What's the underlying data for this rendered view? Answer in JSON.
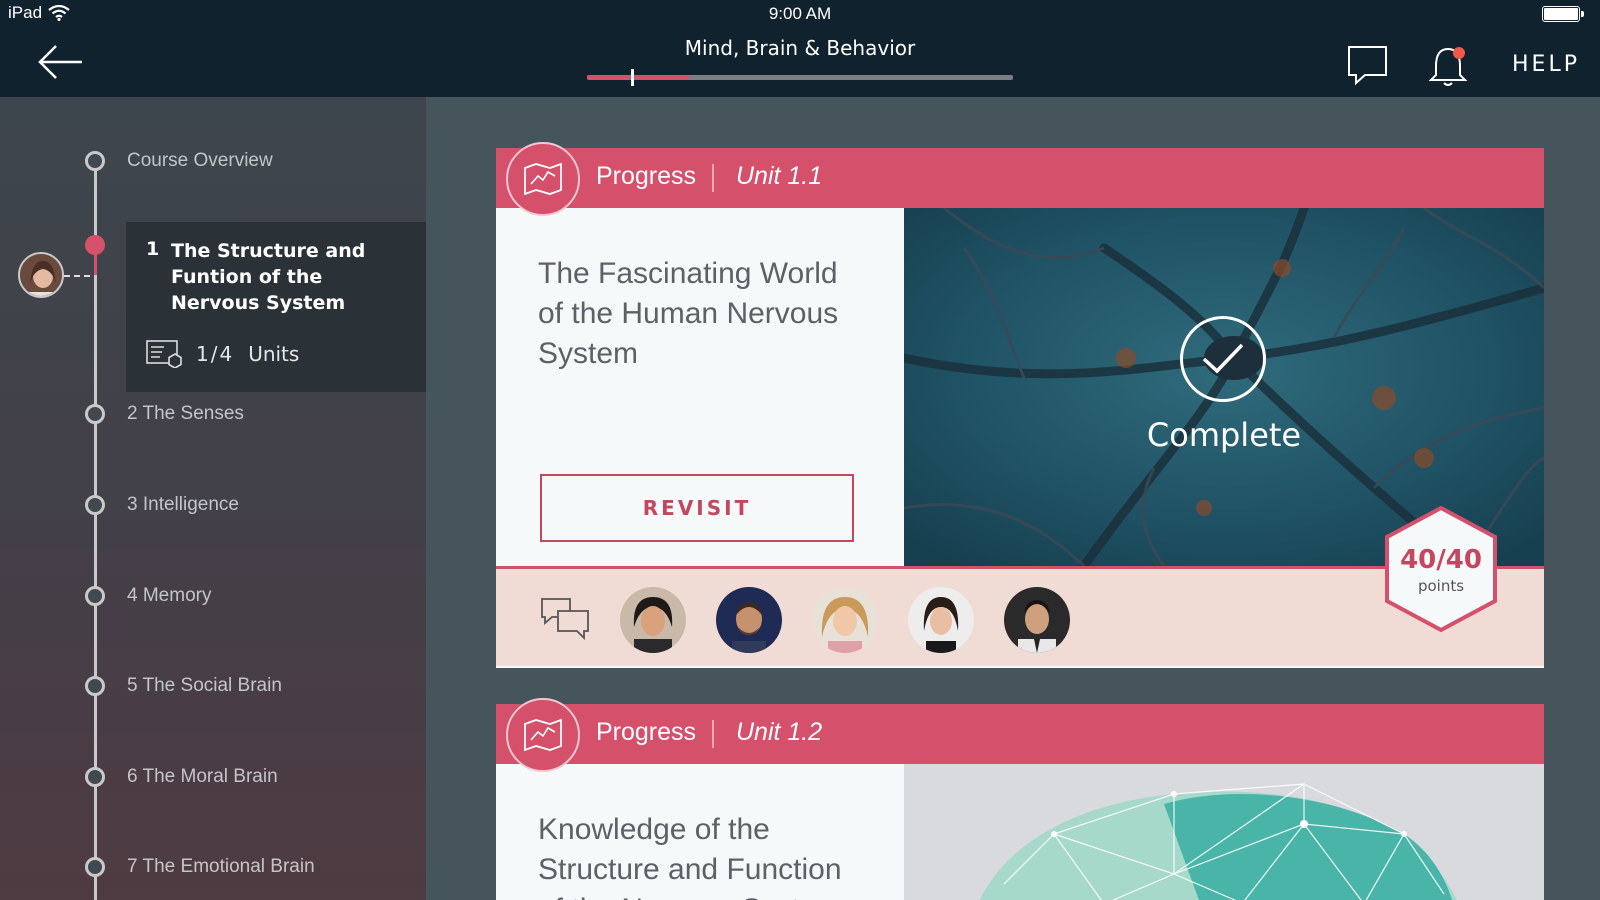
{
  "status_bar": {
    "device": "iPad",
    "time": "9:00 AM"
  },
  "header": {
    "course_title": "Mind, Brain & Behavior",
    "course_progress_fraction": 0.24,
    "help_label": "HELP"
  },
  "sidebar": {
    "items": [
      {
        "label": "Course Overview"
      },
      {
        "label": "2 The Senses"
      },
      {
        "label": "3 Intelligence"
      },
      {
        "label": "4 Memory"
      },
      {
        "label": "5 The Social Brain"
      },
      {
        "label": "6 The Moral Brain"
      },
      {
        "label": "7 The Emotional Brain"
      }
    ],
    "active": {
      "number": "1",
      "title": "The Structure and Funtion of the Nervous System",
      "units_count": "1/4",
      "units_label": "Units"
    }
  },
  "cards": [
    {
      "progress_label": "Progress",
      "unit": "Unit 1.1",
      "title": "The Fascinating World of the Human Nervous System",
      "action_label": "REVISIT",
      "status_label": "Complete",
      "points": "40/40",
      "points_label": "points"
    },
    {
      "progress_label": "Progress",
      "unit": "Unit 1.2",
      "title": "Knowledge of the Structure and Function of the Nervous System"
    }
  ],
  "colors": {
    "accent": "#d4506b",
    "topbar": "#10222e",
    "card_bg": "#f6f9fa",
    "footer_bg": "#f1dcd5"
  }
}
